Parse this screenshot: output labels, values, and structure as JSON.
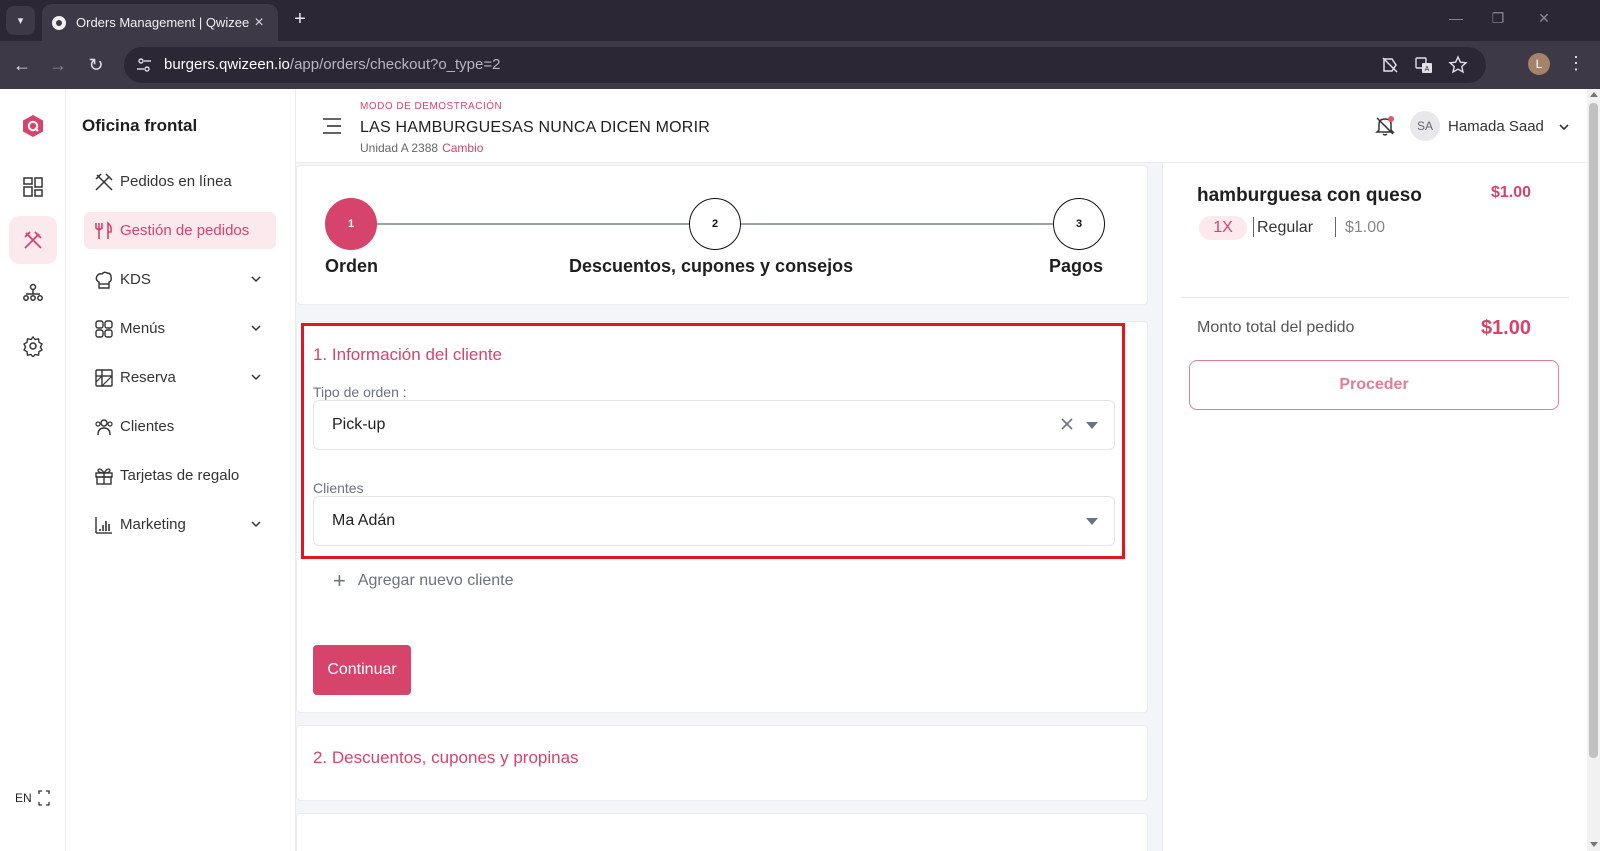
{
  "browser": {
    "tab_title": "Orders Management | Qwizeen",
    "url_host": "burgers.qwizeen.io",
    "url_path": "/app/orders/checkout?o_type=2",
    "profile_initial": "L"
  },
  "rail": {
    "language": "EN"
  },
  "sidebar": {
    "title": "Oficina frontal",
    "items": [
      {
        "label": "Pedidos en línea",
        "icon": "utensils-icon",
        "expandable": false
      },
      {
        "label": "Gestión de pedidos",
        "icon": "fork-knife-icon",
        "expandable": false,
        "active": true
      },
      {
        "label": "KDS",
        "icon": "chef-hat-icon",
        "expandable": true
      },
      {
        "label": "Menús",
        "icon": "grid-icon",
        "expandable": true
      },
      {
        "label": "Reserva",
        "icon": "table-icon",
        "expandable": true
      },
      {
        "label": "Clientes",
        "icon": "users-icon",
        "expandable": false
      },
      {
        "label": "Tarjetas de regalo",
        "icon": "gift-icon",
        "expandable": false
      },
      {
        "label": "Marketing",
        "icon": "bar-chart-icon",
        "expandable": true
      }
    ]
  },
  "header": {
    "demo_label": "MODO DE DEMOSTRACIÓN",
    "store_name": "LAS HAMBURGUESAS NUNCA DICEN MORIR",
    "unit": "Unidad A 2388",
    "change_link": "Cambio",
    "user_initials": "SA",
    "user_name": "Hamada Saad"
  },
  "stepper": {
    "steps": [
      {
        "number": "1",
        "label": "Orden",
        "active": true
      },
      {
        "number": "2",
        "label": "Descuentos, cupones y consejos",
        "active": false
      },
      {
        "number": "3",
        "label": "Pagos",
        "active": false
      }
    ]
  },
  "customer_info": {
    "title": "1. Información del cliente",
    "order_type_label": "Tipo de orden :",
    "order_type_value": "Pick-up",
    "clients_label": "Clientes",
    "client_value": "Ma Adán",
    "add_client": "Agregar nuevo cliente",
    "continue_label": "Continuar"
  },
  "discounts": {
    "title": "2. Descuentos, cupones y propinas"
  },
  "summary": {
    "item_name": "hamburguesa con queso",
    "item_price": "$1.00",
    "qty": "1X",
    "variant": "Regular",
    "unit_price": "$1.00",
    "total_label": "Monto total del pedido",
    "total_value": "$1.00",
    "proceed_label": "Proceder"
  },
  "colors": {
    "accent": "#d6436b",
    "highlight_border": "#e5151f"
  }
}
